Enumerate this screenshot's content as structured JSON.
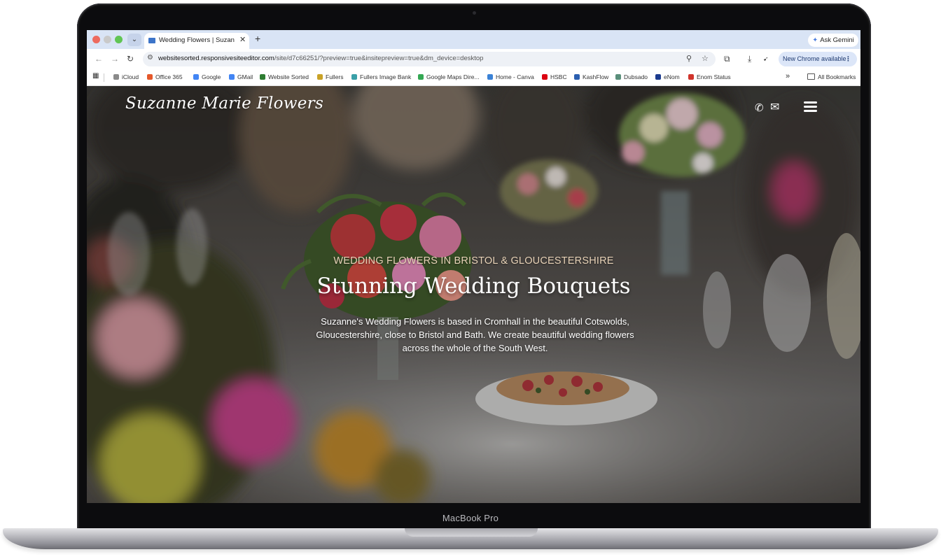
{
  "device": {
    "label": "MacBook Pro"
  },
  "browser": {
    "tab_title": "Wedding Flowers | Suzanne M",
    "new_tab_symbol": "+",
    "tab_close_symbol": "✕",
    "ask_gemini": "Ask Gemini",
    "url_host": "websitesorted.responsivesiteeditor.com",
    "url_rest": "/site/d7c66251/?preview=true&insitepreview=true&dm_device=desktop",
    "new_chrome": "New Chrome available",
    "bookmarks": [
      {
        "label": "iCloud",
        "color": "#8a8a8a"
      },
      {
        "label": "Office 365",
        "color": "#e5582b"
      },
      {
        "label": "Google",
        "color": "#4285f4"
      },
      {
        "label": "GMail",
        "color": "#4285f4"
      },
      {
        "label": "Website Sorted",
        "color": "#2e7d32"
      },
      {
        "label": "Fullers",
        "color": "#c9a227"
      },
      {
        "label": "Fullers Image Bank",
        "color": "#3aa0a8"
      },
      {
        "label": "Google Maps Dire...",
        "color": "#34a853"
      },
      {
        "label": "Home - Canva",
        "color": "#3b82d6"
      },
      {
        "label": "HSBC",
        "color": "#db0011"
      },
      {
        "label": "KashFlow",
        "color": "#2b5fb0"
      },
      {
        "label": "Dubsado",
        "color": "#5a8f7b"
      },
      {
        "label": "eNom",
        "color": "#1b3b8f"
      },
      {
        "label": "Enom Status",
        "color": "#d0342c"
      }
    ],
    "all_bookmarks": "All Bookmarks",
    "overflow": "»"
  },
  "site": {
    "logo": "Suzanne Marie Flowers",
    "kicker": "WEDDING FLOWERS IN BRISTOL & GLOUCESTERSHIRE",
    "headline": "Stunning Wedding Bouquets",
    "intro": "Suzanne's Wedding Flowers is based in Cromhall in the beautiful Cotswolds, Gloucestershire, close to Bristol and Bath. We create beautiful wedding flowers across the whole of the South West.",
    "icons": {
      "phone": "phone-icon",
      "mail": "mail-icon",
      "menu": "hamburger-menu-icon"
    }
  },
  "colors": {
    "kicker": "#e8d3b8",
    "tabstrip": "#d9e4f5",
    "accent": "#3c74c9"
  }
}
